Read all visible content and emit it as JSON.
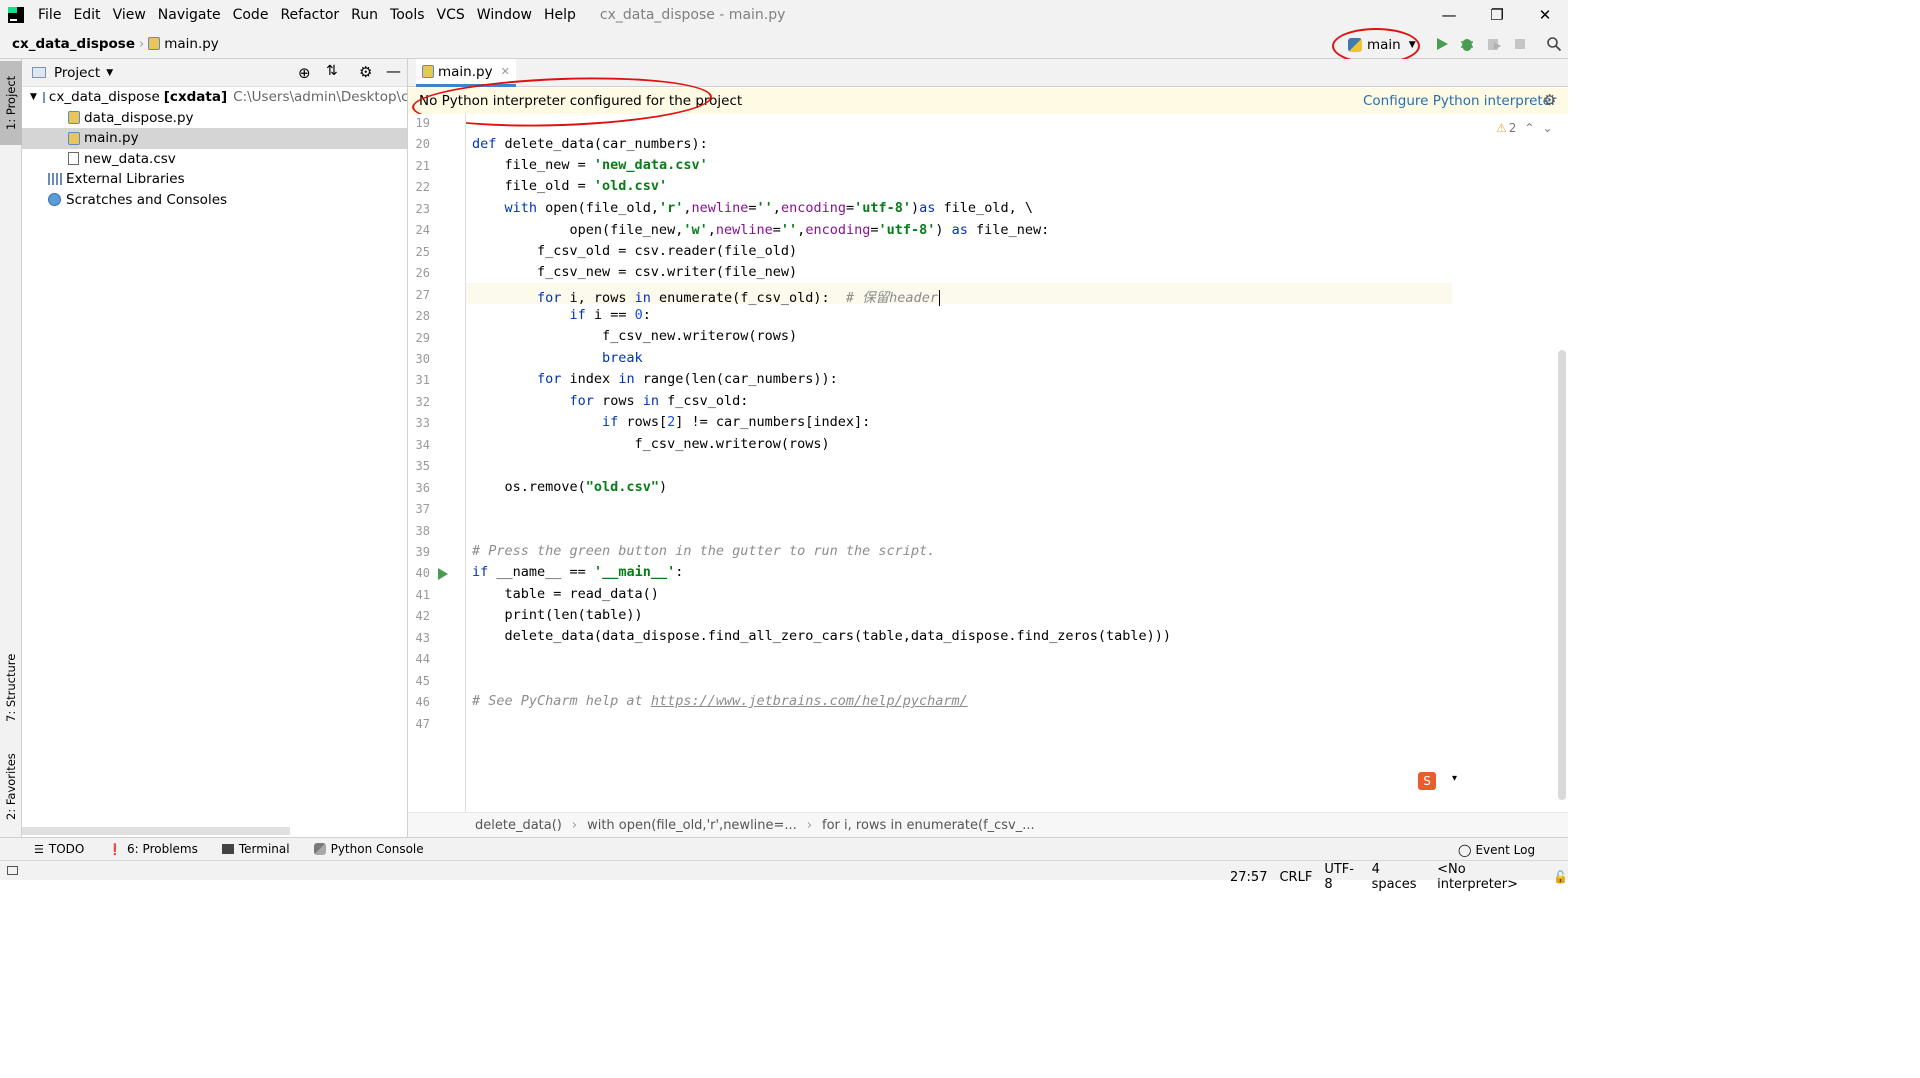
{
  "menubar": {
    "items": [
      "File",
      "Edit",
      "View",
      "Navigate",
      "Code",
      "Refactor",
      "Run",
      "Tools",
      "VCS",
      "Window",
      "Help"
    ],
    "window_title": "cx_data_dispose - main.py"
  },
  "navbar": {
    "project": "cx_data_dispose",
    "file": "main.py",
    "run_config": "main"
  },
  "left_strip": {
    "project_tab": "1: Project",
    "structure_tab": "7: Structure",
    "favorites_tab": "2: Favorites"
  },
  "project_panel": {
    "title": "Project",
    "tree": [
      {
        "label": "cx_data_dispose",
        "module": "[cxdata]",
        "path": "C:\\Users\\admin\\Desktop\\cx_da"
      },
      {
        "label": "data_dispose.py"
      },
      {
        "label": "main.py"
      },
      {
        "label": "new_data.csv"
      },
      {
        "label": "External Libraries"
      },
      {
        "label": "Scratches and Consoles"
      }
    ]
  },
  "editor": {
    "tab_label": "main.py",
    "banner_text": "No Python interpreter configured for the project",
    "banner_action": "Configure Python interpreter",
    "warnings_count": "2",
    "line_numbers": [
      "19",
      "20",
      "21",
      "22",
      "23",
      "24",
      "25",
      "26",
      "27",
      "28",
      "29",
      "30",
      "31",
      "32",
      "33",
      "34",
      "35",
      "36",
      "37",
      "38",
      "39",
      "40",
      "41",
      "42",
      "43",
      "44",
      "45",
      "46",
      "47"
    ],
    "breadcrumbs": [
      "delete_data()",
      "with open(file_old,'r',newline=...",
      "for i, rows in enumerate(f_csv_..."
    ]
  },
  "bottom_tools": {
    "todo": "TODO",
    "problems": "6: Problems",
    "terminal": "Terminal",
    "python_console": "Python Console",
    "event_log": "Event Log"
  },
  "status": {
    "position": "27:57",
    "line_sep": "CRLF",
    "encoding": "UTF-8",
    "indent": "4 spaces",
    "interpreter": "<No interpreter>"
  },
  "colors": {
    "accent": "#4083c9",
    "annotation_red": "#e01010",
    "banner_bg": "#fffae3",
    "run_green": "#499c54"
  }
}
